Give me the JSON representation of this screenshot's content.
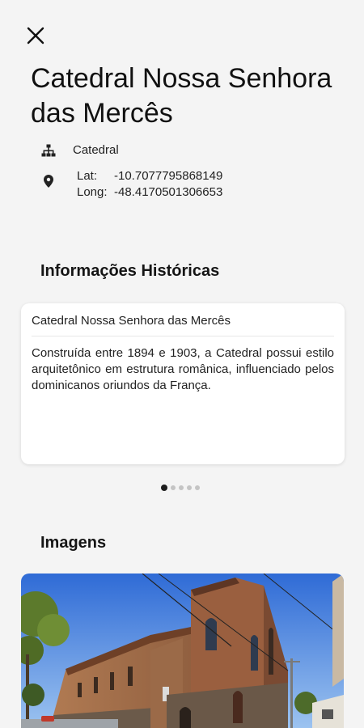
{
  "header": {
    "title": "Catedral Nossa Senhora das Mercês"
  },
  "meta": {
    "type_label": "Catedral",
    "lat_label": "Lat:",
    "lat_value": "-10.7077795868149",
    "long_label": "Long:",
    "long_value": "-48.4170501306653"
  },
  "sections": {
    "history_title": "Informações Históricas",
    "images_title": "Imagens"
  },
  "history_card": {
    "title": "Catedral Nossa Senhora das Mercês",
    "body": "Construída entre 1894 e 1903, a Catedral possui estilo arquitetônico em estrutura românica, influenciado pelos dominicanos oriundos da França."
  },
  "pager": {
    "count": 5,
    "active_index": 0
  },
  "icons": {
    "close": "close-icon",
    "type": "sitemap-icon",
    "location": "location-pin-icon"
  },
  "colors": {
    "background": "#f4f4f4",
    "card": "#ffffff",
    "text": "#1a1a1a",
    "dot_active": "#1e1e1e",
    "dot_inactive": "#c4c4c4"
  }
}
